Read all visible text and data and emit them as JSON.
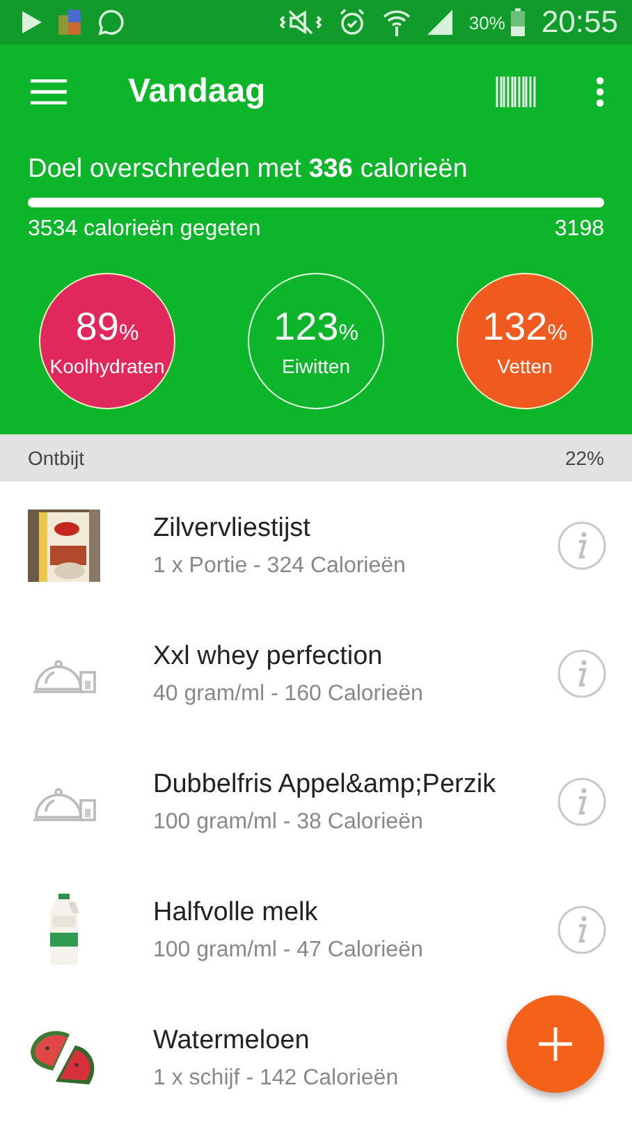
{
  "status_bar": {
    "battery": "30%",
    "time": "20:55"
  },
  "toolbar": {
    "title": "Vandaag"
  },
  "summary": {
    "goal_text": "Doel overschreden met **336** calorieën",
    "level": 1,
    "eaten": "3534 calorieën gegeten",
    "target": "3198"
  },
  "macros": [
    {
      "value": "89",
      "unit": "%",
      "label": "Koolhydraten",
      "kind": "filled",
      "color": "#e0285c"
    },
    {
      "value": "123",
      "unit": "%",
      "label": "Eiwitten",
      "kind": "outline"
    },
    {
      "value": "132",
      "unit": "%",
      "label": "Vetten",
      "kind": "filled",
      "color": "#f05a1e"
    }
  ],
  "section": {
    "title": "Ontbijt",
    "percent": "22%"
  },
  "entries": [
    {
      "name": "Zilvervliestijst",
      "detail": "1 x Portie - 324 Calorieën",
      "kind": "rice"
    },
    {
      "name": "Xxl whey perfection",
      "detail": "40 gram/ml - 160 Calorieën",
      "kind": "dish"
    },
    {
      "name": "Dubbelfris Appel&amp;Perzik",
      "detail": "100 gram/ml - 38 Calorieën",
      "kind": "dish"
    },
    {
      "name": "Halfvolle melk",
      "detail": "100 gram/ml - 47 Calorieën",
      "kind": "milk"
    },
    {
      "name": "Watermeloen",
      "detail": "1 x schijf - 142 Calorieën",
      "kind": "melon"
    }
  ]
}
